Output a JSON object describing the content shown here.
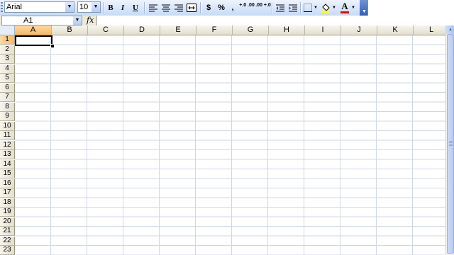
{
  "toolbar": {
    "font_name": "Arial",
    "font_size": "10",
    "bold_label": "B",
    "italic_label": "I",
    "underline_label": "U",
    "currency_label": "$",
    "percent_label": "%",
    "comma_label": ",",
    "increase_decimal_label": "+.0 .00",
    "decrease_decimal_label": ".00 +.0",
    "font_color_label": "A",
    "fill_color": "#ffff00",
    "font_color": "#ff0000"
  },
  "formula_bar": {
    "name_box": "A1",
    "fx_label": "fx",
    "formula": ""
  },
  "sheet": {
    "columns": [
      "A",
      "B",
      "C",
      "D",
      "E",
      "F",
      "G",
      "H",
      "I",
      "J",
      "K",
      "L"
    ],
    "rows": [
      "1",
      "2",
      "3",
      "4",
      "5",
      "6",
      "7",
      "8",
      "9",
      "10",
      "11",
      "12",
      "13",
      "14",
      "15",
      "16",
      "17",
      "18",
      "19",
      "20",
      "21",
      "22",
      "23"
    ],
    "active_cell": "A1"
  }
}
